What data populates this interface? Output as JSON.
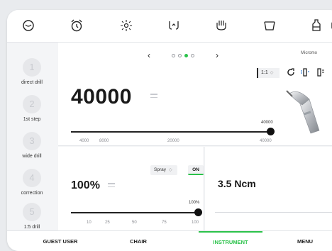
{
  "top_icons": [
    "tooth-scan-icon",
    "alarm-clock-icon",
    "light-icon",
    "cup-icon",
    "cleaning-icon",
    "tray-icon",
    "rinse-icon",
    "card-icon"
  ],
  "steps": [
    {
      "num": "1",
      "label": "direct drill"
    },
    {
      "num": "2",
      "label": "1st step"
    },
    {
      "num": "3",
      "label": "wide drill"
    },
    {
      "num": "4",
      "label": "correction"
    },
    {
      "num": "5",
      "label": "1:5 drill"
    }
  ],
  "pager": {
    "prev": "‹",
    "next": "›",
    "active_index": 2,
    "count": 4
  },
  "mode_label": "Micromo",
  "speed": {
    "value": "40000",
    "ratio": "1:1",
    "slider_value": "40000",
    "slider_min_label": "4000",
    "ticks": [
      "8000",
      "20000",
      "40000"
    ],
    "fraction": 1.0
  },
  "spray_panel": {
    "percent": "100%",
    "spray_label": "Spray",
    "on_label": "ON",
    "slider_value": "100%",
    "ticks": [
      "10",
      "25",
      "50",
      "75",
      "100"
    ],
    "fraction": 1.0
  },
  "torque": {
    "value": "3.5 Ncm"
  },
  "nav": [
    {
      "label": "GUEST USER"
    },
    {
      "label": "CHAIR"
    },
    {
      "label": "INSTRUMENT",
      "active": true
    },
    {
      "label": "MENU"
    }
  ],
  "colors": {
    "accent": "#2bc24a",
    "panel": "#ffffff",
    "background": "#f4f5f7"
  }
}
